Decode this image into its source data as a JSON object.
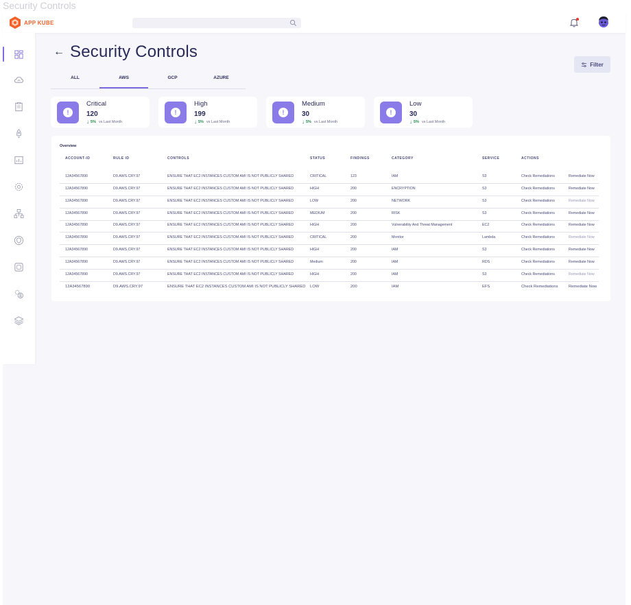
{
  "page_caption": "Security Controls",
  "brand": {
    "logo_text": "APP KUBE",
    "color": "#f2622c"
  },
  "search": {
    "placeholder": ""
  },
  "header": {
    "title": "Security Controls",
    "filter_label": "Filter"
  },
  "tabs": [
    {
      "label": "ALL",
      "active": false
    },
    {
      "label": "AWS",
      "active": true
    },
    {
      "label": "GCP",
      "active": false
    },
    {
      "label": "AZURE",
      "active": false
    }
  ],
  "stats": [
    {
      "label": "Critical",
      "value": "120",
      "change": "5%",
      "note": "vs Last Month"
    },
    {
      "label": "High",
      "value": "199",
      "change": "5%",
      "note": "vs Last Month"
    },
    {
      "label": "Medium",
      "value": "30",
      "change": "5%",
      "note": "vs Last Month"
    },
    {
      "label": "Low",
      "value": "30",
      "change": "5%",
      "note": "vs Last Month"
    }
  ],
  "overview": {
    "title": "Overview",
    "columns": [
      "ACCOUNT-ID",
      "RULE ID",
      "CONTROLS",
      "STATUS",
      "FINDINGS",
      "CATEGORY",
      "SERVICE",
      "ACTIONS"
    ],
    "rows": [
      {
        "account": "12A34567890",
        "rule": "D9.AWS.CRY.97",
        "control": "ENSURE THAT EC2 INSTANCES CUSTOM AMI IS NOT PUBLICLY SHARED",
        "status": "CRITICAL",
        "findings": "123",
        "category": "IAM",
        "service": "S3",
        "action1": "Check Remediations",
        "action2": "Remediate Now"
      },
      {
        "account": "12A34567890",
        "rule": "D9.AWS.CRY.97",
        "control": "ENSURE THAT EC2 INSTANCES CUSTOM AMI IS NOT PUBLICLY SHARED",
        "status": "HIGH",
        "findings": "200",
        "category": "ENCRYPTION",
        "service": "S3",
        "action1": "Check Remediations",
        "action2": "Remediate Now"
      },
      {
        "account": "12A34567890",
        "rule": "D9.AWS.CRY.97",
        "control": "ENSURE THAT EC2 INSTANCES CUSTOM AMI IS NOT PUBLICLY SHARED",
        "status": "LOW",
        "findings": "200",
        "category": "NETWORK",
        "service": "S3",
        "action1": "Check Remediations",
        "action2": "Remediate Now"
      },
      {
        "account": "12A34567890",
        "rule": "D9.AWS.CRY.97",
        "control": "ENSURE THAT EC2 INSTANCES CUSTOM AMI IS NOT PUBLICLY SHARED",
        "status": "MEDIUM",
        "findings": "200",
        "category": "RISK",
        "service": "S3",
        "action1": "Check Remediations",
        "action2": "Remediate Now"
      },
      {
        "account": "12A34567890",
        "rule": "D9.AWS.CRY.97",
        "control": "ENSURE THAT EC2 INSTANCES CUSTOM AMI IS NOT PUBLICLY SHARED",
        "status": "HIGH",
        "findings": "200",
        "category": "Vulnerability And Threat Management",
        "service": "EC2",
        "action1": "Check Remediations",
        "action2": "Remediate Now"
      },
      {
        "account": "12A34567890",
        "rule": "D9.AWS.CRY.97",
        "control": "ENSURE THAT EC2 INSTANCES CUSTOM AMI IS NOT PUBLICLY SHARED",
        "status": "CRITICAL",
        "findings": "200",
        "category": "Monitor",
        "service": "Lambda",
        "action1": "Check Remediations",
        "action2": "Remediate Now"
      },
      {
        "account": "12A34567890",
        "rule": "D9.AWS.CRY.97",
        "control": "ENSURE THAT EC2 INSTANCES CUSTOM AMI IS NOT PUBLICLY SHARED",
        "status": "HIGH",
        "findings": "200",
        "category": "IAM",
        "service": "S3",
        "action1": "Check Remediations",
        "action2": "Remediate Now"
      },
      {
        "account": "12A34567890",
        "rule": "D9.AWS.CRY.97",
        "control": "ENSURE THAT EC2 INSTANCES CUSTOM AMI IS NOT PUBLICLY SHARED",
        "status": "Medium",
        "findings": "200",
        "category": "IAM",
        "service": "RDS",
        "action1": "Check Remediations",
        "action2": "Remediate Now"
      },
      {
        "account": "12A34567890",
        "rule": "D9.AWS.CRY.97",
        "control": "ENSURE THAT EC2 INSTANCES CUSTOM AMI IS NOT PUBLICLY SHARED",
        "status": "HIGH",
        "findings": "200",
        "category": "IAM",
        "service": "S3",
        "action1": "Check Remediations",
        "action2": "Remediate Now"
      },
      {
        "account": "12A34567890",
        "rule": "D9.AWS.CRY.97",
        "control": "ENSURE THAT EC2 INSTANCES CUSTOM AMI IS NOT PUBLICLY SHARED",
        "status": "LOW",
        "findings": "200",
        "category": "IAM",
        "service": "EFS",
        "action1": "Check Remediations",
        "action2": "Remediate Now"
      }
    ]
  },
  "colors": {
    "accent": "#7a6be0",
    "stat_icon": "#8b7be8",
    "positive": "#1b8a4a",
    "notify": "#e53935"
  },
  "icons": {
    "sidebar": [
      "dashboard-icon",
      "cloud-icon",
      "clipboard-icon",
      "rocket-icon",
      "report-icon",
      "cog-icon",
      "network-icon",
      "shield-icon",
      "box-icon",
      "users-gear-icon",
      "layers-icon"
    ],
    "header": [
      "search-icon",
      "bell-icon",
      "avatar"
    ]
  }
}
